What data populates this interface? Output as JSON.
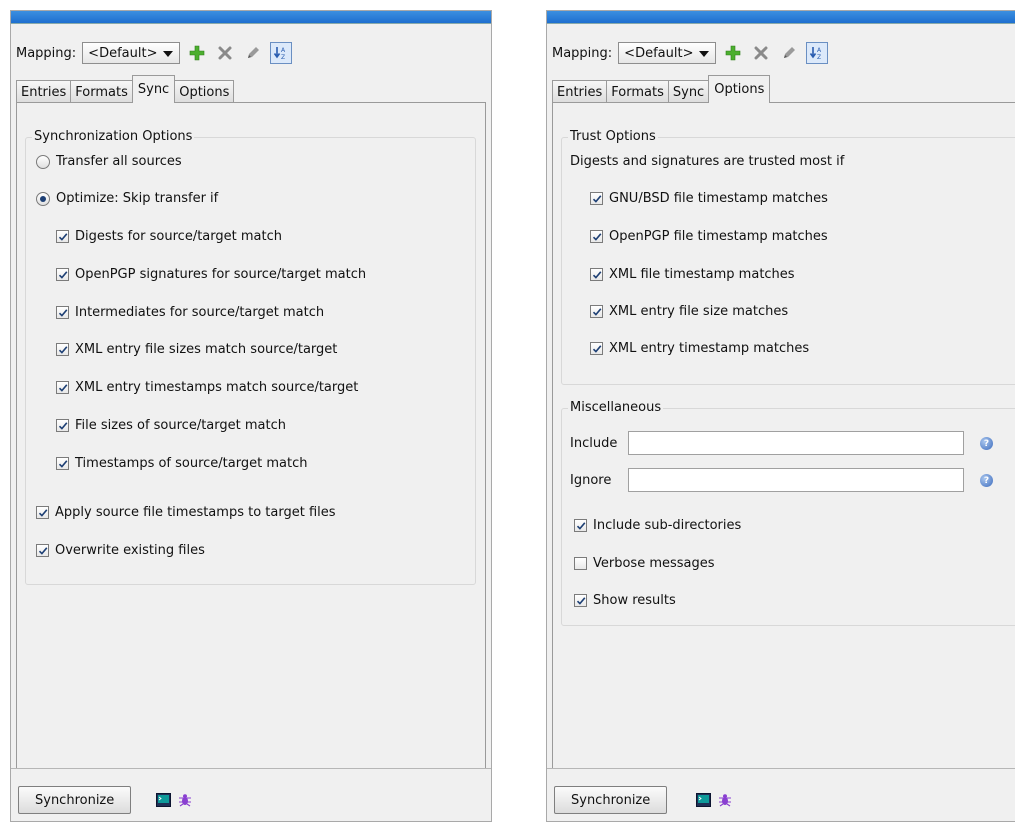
{
  "left_panel": {
    "mapping_label": "Mapping:",
    "mapping_value": "<Default>",
    "tabs": [
      "Entries",
      "Formats",
      "Sync",
      "Options"
    ],
    "sync": {
      "group_title": "Synchronization Options",
      "radio_transfer_all": "Transfer all sources",
      "radio_optimize": "Optimize: Skip transfer if",
      "optimize_checks": [
        "Digests for source/target match",
        "OpenPGP signatures for source/target match",
        "Intermediates for source/target match",
        "XML entry file sizes match source/target",
        "XML entry timestamps match source/target",
        "File sizes of source/target match",
        "Timestamps of source/target match"
      ],
      "apply_timestamps": "Apply source file timestamps to target files",
      "overwrite_existing": "Overwrite existing files"
    },
    "synchronize_button": "Synchronize"
  },
  "right_panel": {
    "mapping_label": "Mapping:",
    "mapping_value": "<Default>",
    "tabs": [
      "Entries",
      "Formats",
      "Sync",
      "Options"
    ],
    "trust": {
      "group_title": "Trust Options",
      "subtitle": "Digests and signatures are trusted most if",
      "checks": [
        "GNU/BSD file timestamp matches",
        "OpenPGP file timestamp matches",
        "XML file timestamp matches",
        "XML entry file size matches",
        "XML entry timestamp matches"
      ]
    },
    "misc": {
      "group_title": "Miscellaneous",
      "include_label": "Include",
      "include_value": "",
      "ignore_label": "Ignore",
      "ignore_value": "",
      "include_subdirs": "Include sub-directories",
      "verbose_messages": "Verbose messages",
      "show_results": "Show results"
    },
    "synchronize_button": "Synchronize"
  },
  "icons": {
    "add": "add-icon",
    "delete": "delete-icon",
    "edit": "edit-icon",
    "sort": "sort-icon",
    "console": "console-icon",
    "debug": "debug-icon"
  },
  "colors": {
    "titlebar": "#2f82dc",
    "add_green": "#4caf2e",
    "radio_dot": "#1d3f74"
  }
}
